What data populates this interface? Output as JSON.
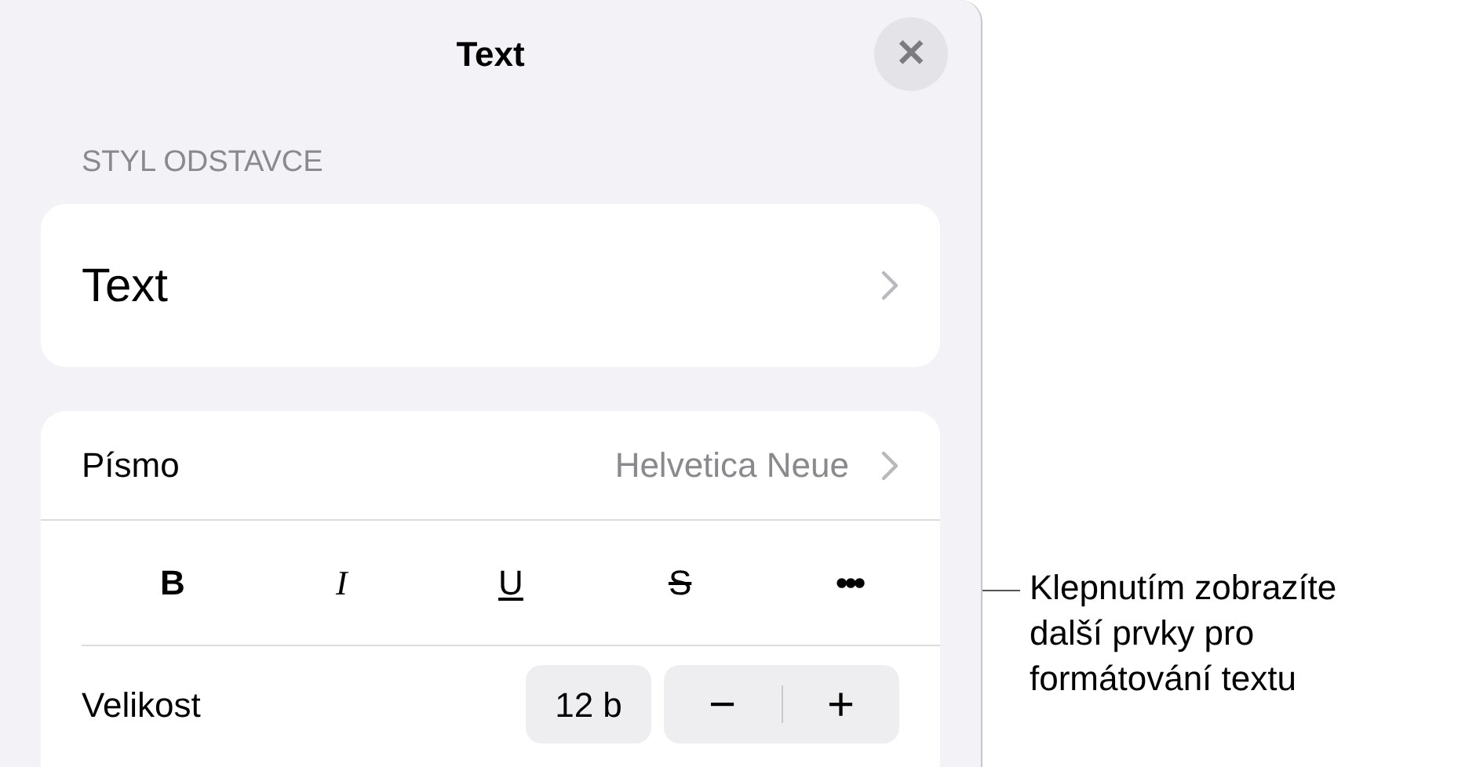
{
  "panel": {
    "title": "Text",
    "close": "✕",
    "section_header": "STYL ODSTAVCE",
    "paragraph_style": {
      "value": "Text"
    },
    "font_row": {
      "label": "Písmo",
      "value": "Helvetica Neue"
    },
    "format_buttons": [
      {
        "kind": "bold",
        "label": "B",
        "selected": false
      },
      {
        "kind": "italic",
        "label": "I",
        "selected": false
      },
      {
        "kind": "underline",
        "label": "U",
        "selected": false
      },
      {
        "kind": "strikethrough",
        "label": "S",
        "selected": false
      },
      {
        "kind": "more",
        "label": "•••",
        "selected": false
      }
    ],
    "size_row": {
      "label": "Velikost",
      "value": "12 b",
      "decrease": "−",
      "increase": "+"
    }
  },
  "callout": {
    "lines": [
      "Klepnutím zobrazíte",
      "další prvky pro",
      "formátování textu"
    ]
  }
}
